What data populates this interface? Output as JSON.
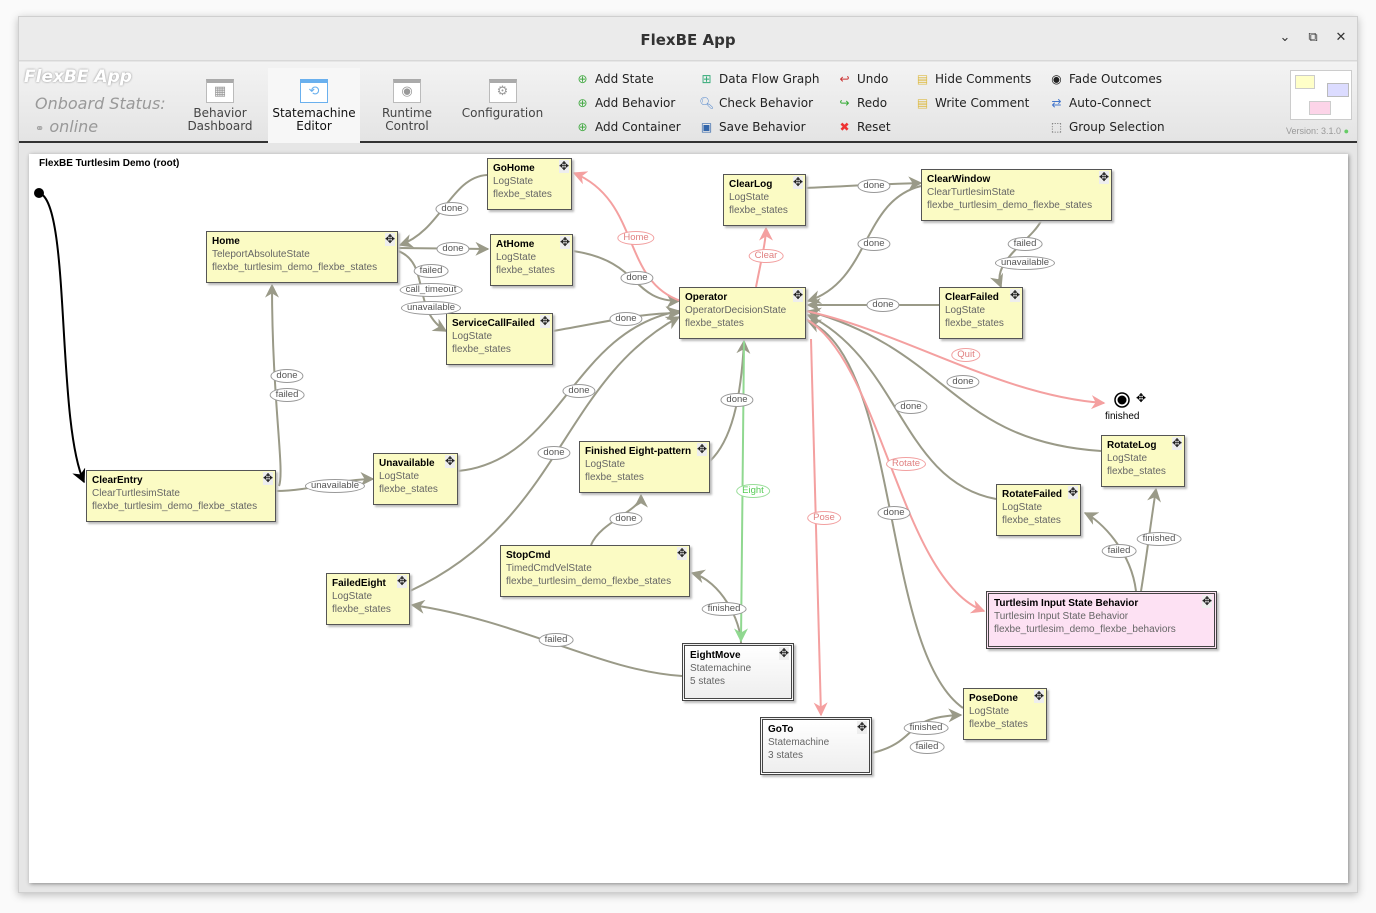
{
  "window": {
    "title": "FlexBE App",
    "controls": [
      "minimize",
      "maximize",
      "close"
    ]
  },
  "toolbar": {
    "app_name": "FlexBE App",
    "onboard_status_label": "Onboard Status:",
    "onboard_status": "online",
    "nav_tabs": [
      {
        "label": "Behavior Dashboard",
        "active": false
      },
      {
        "label": "Statemachine Editor",
        "active": true
      },
      {
        "label": "Runtime Control",
        "active": false
      },
      {
        "label": "Configuration",
        "active": false
      }
    ],
    "actions": [
      {
        "label": "Add State",
        "icon": "plus-circle-icon"
      },
      {
        "label": "Add Behavior",
        "icon": "plus-circle-icon"
      },
      {
        "label": "Add Container",
        "icon": "plus-circle-icon"
      },
      {
        "label": "Data Flow Graph",
        "icon": "graph-icon"
      },
      {
        "label": "Check Behavior",
        "icon": "magnifier-icon"
      },
      {
        "label": "Save Behavior",
        "icon": "floppy-icon"
      },
      {
        "label": "Undo",
        "icon": "undo-icon"
      },
      {
        "label": "Redo",
        "icon": "redo-icon"
      },
      {
        "label": "Reset",
        "icon": "x-icon"
      },
      {
        "label": "Hide Comments",
        "icon": "note-icon"
      },
      {
        "label": "Write Comment",
        "icon": "note-add-icon"
      },
      {
        "label": "Fade Outcomes",
        "icon": "radio-icon"
      },
      {
        "label": "Auto-Connect",
        "icon": "arrows-icon"
      },
      {
        "label": "Group Selection",
        "icon": "group-icon"
      }
    ],
    "version": "Version: 3.1.0"
  },
  "canvas": {
    "root_title": "FlexBE Turtlesim Demo (root)",
    "terminal": "finished",
    "colors": {
      "edge": "#9a9a88",
      "edge_red": "#f4a0a0",
      "edge_green": "#90d890",
      "state": "#fbfbc4",
      "behavior": "#fde1f3"
    },
    "nodes": [
      {
        "name": "GoHome",
        "type": "LogState",
        "pkg": "flexbe_states"
      },
      {
        "name": "Home",
        "type": "TeleportAbsoluteState",
        "pkg": "flexbe_turtlesim_demo_flexbe_states"
      },
      {
        "name": "AtHome",
        "type": "LogState",
        "pkg": "flexbe_states"
      },
      {
        "name": "ServiceCallFailed",
        "type": "LogState",
        "pkg": "flexbe_states"
      },
      {
        "name": "ClearLog",
        "type": "LogState",
        "pkg": "flexbe_states"
      },
      {
        "name": "ClearWindow",
        "type": "ClearTurtlesimState",
        "pkg": "flexbe_turtlesim_demo_flexbe_states"
      },
      {
        "name": "Operator",
        "type": "OperatorDecisionState",
        "pkg": "flexbe_states"
      },
      {
        "name": "ClearFailed",
        "type": "LogState",
        "pkg": "flexbe_states"
      },
      {
        "name": "Unavailable",
        "type": "LogState",
        "pkg": "flexbe_states"
      },
      {
        "name": "ClearEntry",
        "type": "ClearTurtlesimState",
        "pkg": "flexbe_turtlesim_demo_flexbe_states"
      },
      {
        "name": "Finished Eight-pattern",
        "type": "LogState",
        "pkg": "flexbe_states"
      },
      {
        "name": "StopCmd",
        "type": "TimedCmdVelState",
        "pkg": "flexbe_turtlesim_demo_flexbe_states"
      },
      {
        "name": "FailedEight",
        "type": "LogState",
        "pkg": "flexbe_states"
      },
      {
        "name": "EightMove",
        "type": "Statemachine",
        "pkg": "5 states"
      },
      {
        "name": "GoTo",
        "type": "Statemachine",
        "pkg": "3 states"
      },
      {
        "name": "RotateLog",
        "type": "LogState",
        "pkg": "flexbe_states"
      },
      {
        "name": "RotateFailed",
        "type": "LogState",
        "pkg": "flexbe_states"
      },
      {
        "name": "Turtlesim Input State Behavior",
        "type": "Turtlesim Input State Behavior",
        "pkg": "flexbe_turtlesim_demo_flexbe_behaviors"
      },
      {
        "name": "PoseDone",
        "type": "LogState",
        "pkg": "flexbe_states"
      }
    ],
    "outcome_labels": [
      "done",
      "done",
      "failed",
      "call_timeout",
      "unavailable",
      "Home",
      "done",
      "done",
      "Clear",
      "done",
      "done",
      "failed",
      "unavailable",
      "done",
      "Quit",
      "done",
      "done",
      "done",
      "done",
      "done",
      "Eight",
      "Rotate",
      "done",
      "Pose",
      "done",
      "failed",
      "unavailable",
      "done",
      "finished",
      "failed",
      "finished",
      "failed",
      "finished",
      "failed"
    ]
  }
}
